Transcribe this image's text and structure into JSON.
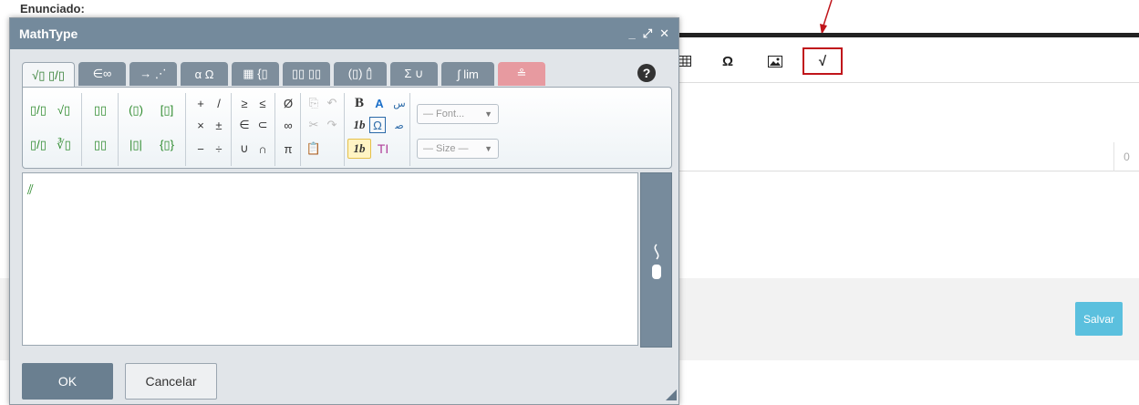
{
  "page": {
    "heading": "Enunciado:",
    "counter": "0",
    "save_label": "Salvar"
  },
  "editor_toolbar": {
    "table_icon": "table-icon",
    "omega": "Ω",
    "image_icon": "image-icon",
    "mathtype_icon": "√"
  },
  "dialog": {
    "title": "MathType",
    "controls": [
      "_",
      "⤢",
      "✕"
    ],
    "tabs": [
      "√▯ ▯/▯",
      "∈∞",
      "→ ⋰",
      "α Ω",
      "▦ {▯",
      "▯▯ ▯▯",
      "(▯) ▯̂",
      "Σ ∪",
      "∫ lim",
      "≗"
    ],
    "help": "?",
    "symbols": {
      "frac": "▯/▯",
      "sqrt": "√▯",
      "sup": "▯▯",
      "paren": "(▯)",
      "bracket": "[▯]",
      "bevel": "▯/▯",
      "root": "∛▯",
      "sub": "▯▯",
      "abs": "|▯|",
      "brace": "{▯}",
      "plus": "+",
      "slash": "/",
      "ge": "≥",
      "le": "≤",
      "empty": "Ø",
      "times": "×",
      "pm": "±",
      "in": "∈",
      "subset": "⊂",
      "infty": "∞",
      "minus": "−",
      "div": "÷",
      "cup": "∪",
      "cap": "∩",
      "pi": "π",
      "bold": "B",
      "color": "A",
      "italic": "1b",
      "omega_box": "Ω",
      "italic_hl": "1b",
      "text_tool": "TI"
    },
    "font_dropdown": "— Font...",
    "size_dropdown": "— Size —",
    "ok": "OK",
    "cancel": "Cancelar"
  }
}
